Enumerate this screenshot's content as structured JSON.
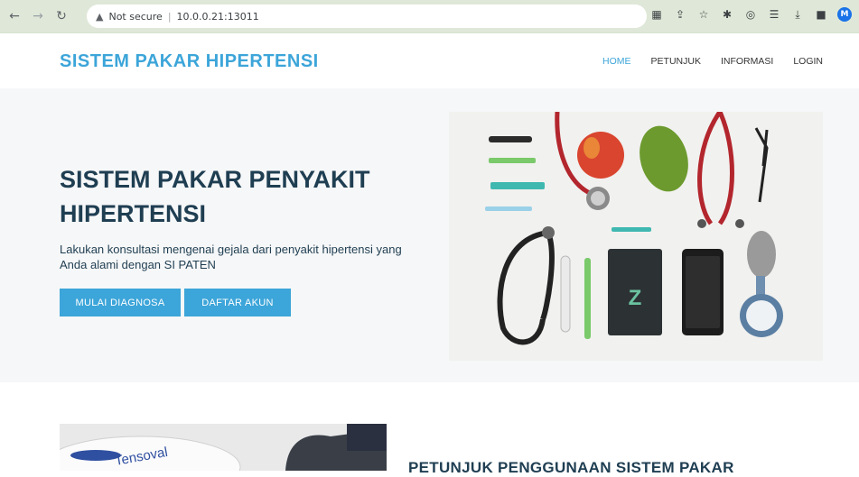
{
  "browser": {
    "security_label": "Not secure",
    "url": "10.0.0.21:13011",
    "avatar_letter": "M"
  },
  "site": {
    "brand": "SISTEM PAKAR HIPERTENSI",
    "menu": [
      {
        "label": "HOME",
        "active": true
      },
      {
        "label": "PETUNJUK",
        "active": false
      },
      {
        "label": "INFORMASI",
        "active": false
      },
      {
        "label": "LOGIN",
        "active": false
      }
    ]
  },
  "hero": {
    "title": "SISTEM PAKAR PENYAKIT HIPERTENSI",
    "subtitle": "Lakukan konsultasi mengenai gejala dari penyakit hipertensi yang Anda alami dengan SI PATEN",
    "btn_diagnosa": "MULAI DIAGNOSA",
    "btn_daftar": "DAFTAR AKUN",
    "photo_brand_letter": "Z"
  },
  "section2": {
    "title": "PETUNJUK PENGGUNAAN SISTEM PAKAR",
    "photo_text": "Tensoval"
  },
  "colors": {
    "accent": "#3ca5d9",
    "heading": "#1f3e52"
  }
}
